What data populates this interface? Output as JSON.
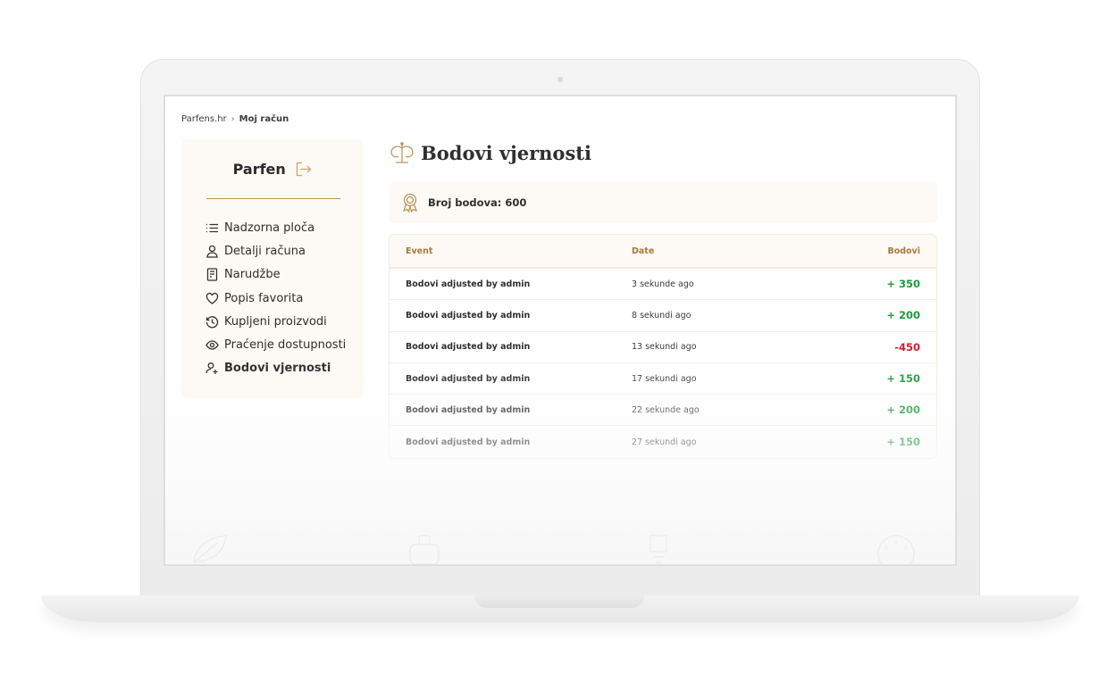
{
  "breadcrumb": {
    "home": "Parfens.hr",
    "separator": "›",
    "current": "Moj račun"
  },
  "sidebar": {
    "brand": "Parfen",
    "items": [
      {
        "label": "Nadzorna ploča",
        "icon": "list-icon"
      },
      {
        "label": "Detalji računa",
        "icon": "user-icon"
      },
      {
        "label": "Narudžbe",
        "icon": "receipt-icon"
      },
      {
        "label": "Popis favorita",
        "icon": "heart-icon"
      },
      {
        "label": "Kupljeni proizvodi",
        "icon": "history-icon"
      },
      {
        "label": "Praćenje dostupnosti",
        "icon": "eye-icon"
      },
      {
        "label": "Bodovi vjernosti",
        "icon": "user-plus-icon",
        "active": true
      }
    ]
  },
  "page": {
    "title": "Bodovi vjernosti"
  },
  "points": {
    "label": "Broj bodova: 600"
  },
  "table": {
    "headers": {
      "event": "Event",
      "date": "Date",
      "points": "Bodovi"
    },
    "rows": [
      {
        "event": "Bodovi adjusted by admin",
        "date": "3 sekunde ago",
        "points": "+ 350",
        "sign": "pos"
      },
      {
        "event": "Bodovi adjusted by admin",
        "date": "8 sekundi ago",
        "points": "+ 200",
        "sign": "pos"
      },
      {
        "event": "Bodovi adjusted by admin",
        "date": "13 sekundi ago",
        "points": "-450",
        "sign": "neg"
      },
      {
        "event": "Bodovi adjusted by admin",
        "date": "17 sekundi ago",
        "points": "+ 150",
        "sign": "pos"
      },
      {
        "event": "Bodovi adjusted by admin",
        "date": "22 sekunde ago",
        "points": "+ 200",
        "sign": "pos"
      },
      {
        "event": "Bodovi adjusted by admin",
        "date": "27 sekundi ago",
        "points": "+ 150",
        "sign": "pos"
      }
    ]
  },
  "colors": {
    "accent": "#b8924e",
    "positive": "#1f9a3c",
    "negative": "#d1202b",
    "panel": "#fdf9f4"
  }
}
